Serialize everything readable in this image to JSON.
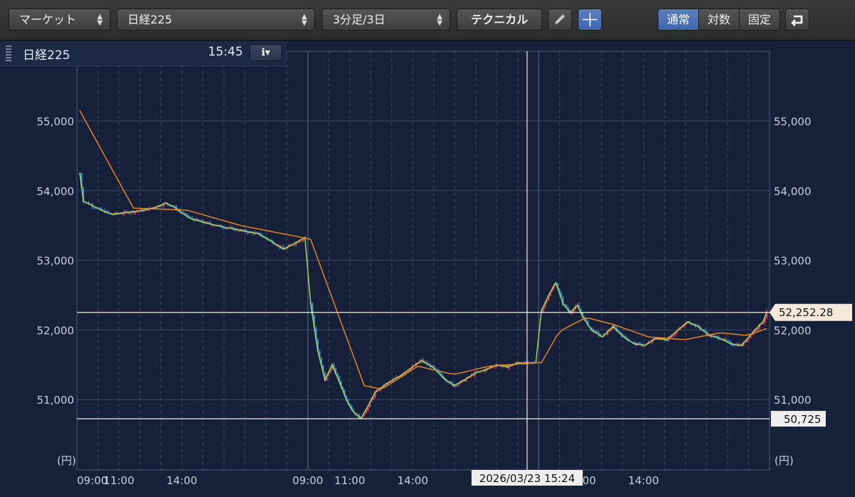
{
  "toolbar": {
    "market_select": "マーケット",
    "symbol_select": "日経225",
    "period_select": "3分足/3日",
    "technical_button": "テクニカル",
    "pencil_icon": "pencil-icon",
    "crosshair_icon": "crosshair-icon",
    "scale_modes": [
      "通常",
      "対数",
      "固定"
    ],
    "active_scale_mode": "通常",
    "undo_icon": "undo-arrow-icon"
  },
  "panel": {
    "symbol": "日経225",
    "time": "15:45",
    "info_icon": "info-icon"
  },
  "colors": {
    "background": "#16213a",
    "grid": "#3a4a66",
    "candle_up": "#e0475c",
    "candle_down": "#3f8ad6",
    "ma_short": "#a9e05a",
    "ma_long": "#f08c22"
  },
  "chart_data": {
    "type": "candlestick",
    "unit_label": "(円)",
    "y_ticks": [
      "51,000",
      "52,000",
      "53,000",
      "54,000",
      "55,000"
    ],
    "y_tick_values": [
      51000,
      52000,
      53000,
      54000,
      55000
    ],
    "ylim": [
      50000,
      56000
    ],
    "x_tick_labels": [
      "09:00",
      "11:00",
      "14:00",
      "09:00",
      "11:00",
      "14:00",
      "11:00",
      "14:00"
    ],
    "sessions": 3,
    "price_marker": "52,252.28",
    "low_marker": "50,725",
    "cursor_label": "2026/03/23 15:24",
    "session_path": [
      [
        [
          0,
          54250
        ],
        [
          2,
          53850
        ],
        [
          6,
          53800
        ],
        [
          12,
          53720
        ],
        [
          18,
          53660
        ],
        [
          24,
          53680
        ],
        [
          30,
          53700
        ],
        [
          36,
          53720
        ],
        [
          42,
          53760
        ],
        [
          48,
          53820
        ],
        [
          52,
          53780
        ],
        [
          56,
          53700
        ],
        [
          62,
          53600
        ],
        [
          70,
          53540
        ],
        [
          80,
          53480
        ],
        [
          90,
          53430
        ],
        [
          100,
          53380
        ],
        [
          108,
          53260
        ],
        [
          114,
          53160
        ],
        [
          120,
          53240
        ],
        [
          126,
          53330
        ]
      ],
      [
        [
          0,
          52380
        ],
        [
          4,
          51700
        ],
        [
          8,
          51280
        ],
        [
          12,
          51500
        ],
        [
          16,
          51260
        ],
        [
          20,
          51000
        ],
        [
          24,
          50820
        ],
        [
          28,
          50730
        ],
        [
          32,
          50900
        ],
        [
          36,
          51100
        ],
        [
          42,
          51220
        ],
        [
          50,
          51340
        ],
        [
          56,
          51450
        ],
        [
          62,
          51560
        ],
        [
          68,
          51470
        ],
        [
          74,
          51320
        ],
        [
          80,
          51200
        ],
        [
          86,
          51280
        ],
        [
          92,
          51380
        ],
        [
          98,
          51430
        ],
        [
          104,
          51500
        ],
        [
          110,
          51470
        ],
        [
          116,
          51530
        ],
        [
          122,
          51520
        ],
        [
          126,
          51530
        ]
      ],
      [
        [
          0,
          52280
        ],
        [
          4,
          52500
        ],
        [
          8,
          52680
        ],
        [
          12,
          52380
        ],
        [
          16,
          52250
        ],
        [
          20,
          52350
        ],
        [
          24,
          52150
        ],
        [
          28,
          52000
        ],
        [
          34,
          51900
        ],
        [
          40,
          52050
        ],
        [
          46,
          51900
        ],
        [
          52,
          51800
        ],
        [
          58,
          51780
        ],
        [
          64,
          51880
        ],
        [
          70,
          51860
        ],
        [
          76,
          51990
        ],
        [
          82,
          52120
        ],
        [
          88,
          52040
        ],
        [
          94,
          51920
        ],
        [
          100,
          51880
        ],
        [
          106,
          51800
        ],
        [
          112,
          51780
        ],
        [
          118,
          51960
        ],
        [
          124,
          52120
        ],
        [
          126,
          52252
        ]
      ]
    ],
    "ma_long_path": [
      [
        [
          0,
          55150
        ],
        [
          30,
          53750
        ],
        [
          60,
          53720
        ],
        [
          90,
          53500
        ],
        [
          126,
          53320
        ]
      ],
      [
        [
          0,
          53300
        ],
        [
          30,
          51200
        ],
        [
          40,
          51150
        ],
        [
          60,
          51480
        ],
        [
          80,
          51360
        ],
        [
          100,
          51480
        ],
        [
          126,
          51530
        ]
      ],
      [
        [
          0,
          51530
        ],
        [
          10,
          51980
        ],
        [
          25,
          52180
        ],
        [
          40,
          52080
        ],
        [
          60,
          51900
        ],
        [
          80,
          51860
        ],
        [
          100,
          51960
        ],
        [
          115,
          51920
        ],
        [
          126,
          52020
        ]
      ]
    ]
  }
}
